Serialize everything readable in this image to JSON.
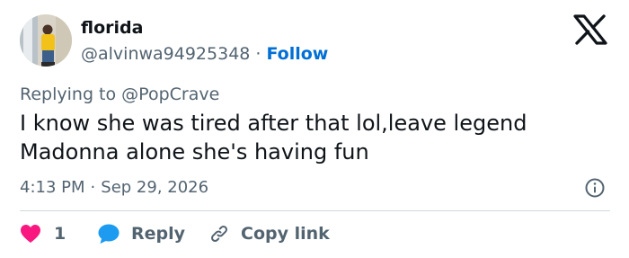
{
  "author": {
    "display_name": "florida",
    "handle": "@alvinwa94925348",
    "separator": "·",
    "follow_label": "Follow"
  },
  "reply_context": {
    "prefix": "Replying to",
    "mention": "@PopCrave"
  },
  "tweet": {
    "text": "I know she was tired after that lol,leave legend Madonna alone she's having fun",
    "time": "4:13 PM",
    "separator": "·",
    "date": "Sep 29, 2026"
  },
  "actions": {
    "like_count": "1",
    "reply_label": "Reply",
    "copy_link_label": "Copy link"
  },
  "colors": {
    "heart": "#f91880",
    "reply_bubble": "#1d9bf0",
    "follow_link": "#006fd6",
    "muted_text": "#536471",
    "divider": "#cfd9de"
  },
  "icons": {
    "brand": "x-logo-icon",
    "info": "info-icon",
    "like": "heart-icon",
    "reply": "reply-bubble-icon",
    "copy": "link-icon"
  }
}
